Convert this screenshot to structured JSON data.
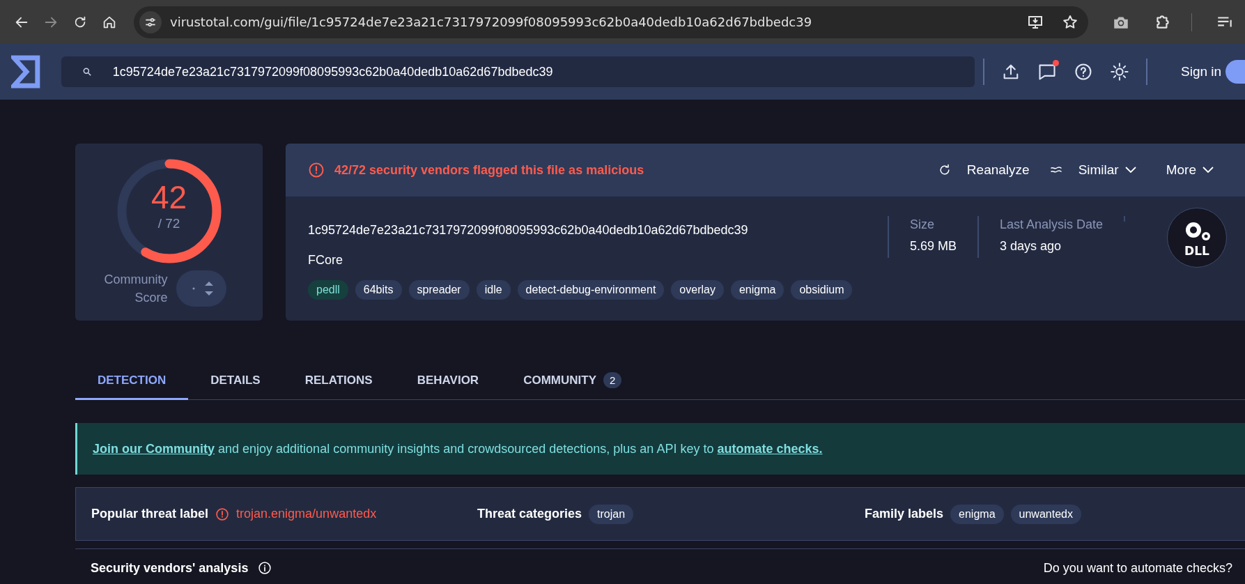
{
  "browser": {
    "url": "virustotal.com/gui/file/1c95724de7e23a21c7317972099f08095993c62b0a40dedb10a62d67bdbedc39",
    "forward_disabled": true
  },
  "header": {
    "search_value": "1c95724de7e23a21c7317972099f08095993c62b0a40dedb10a62d67bdbedc39",
    "sign_in": "Sign in",
    "notification": true
  },
  "score": {
    "detections": "42",
    "total": "/ 72",
    "level": 0.583,
    "community_label": "Community Score"
  },
  "alert": {
    "text": "42/72 security vendors flagged this file as malicious"
  },
  "actions": [
    {
      "kind": "reanalyze",
      "label": "Reanalyze",
      "dropdown": false
    },
    {
      "kind": "similar",
      "label": "Similar",
      "dropdown": true
    },
    {
      "kind": "more",
      "label": "More",
      "dropdown": true
    }
  ],
  "file": {
    "hash": "1c95724de7e23a21c7317972099f08095993c62b0a40dedb10a62d67bdbedc39",
    "name": "FCore",
    "tags": [
      {
        "label": "pedll",
        "highlighted": true
      },
      {
        "label": "64bits",
        "highlighted": false
      },
      {
        "label": "spreader",
        "highlighted": false
      },
      {
        "label": "idle",
        "highlighted": false
      },
      {
        "label": "detect-debug-environment",
        "highlighted": false
      },
      {
        "label": "overlay",
        "highlighted": false
      },
      {
        "label": "enigma",
        "highlighted": false
      },
      {
        "label": "obsidium",
        "highlighted": false
      }
    ],
    "meta": [
      {
        "label": "Size",
        "value": "5.69 MB"
      },
      {
        "label": "Last Analysis Date",
        "value": "3 days ago"
      }
    ],
    "type": "DLL"
  },
  "tabs": [
    {
      "label": "DETECTION",
      "selected": true
    },
    {
      "label": "DETAILS",
      "selected": false
    },
    {
      "label": "RELATIONS",
      "selected": false
    },
    {
      "label": "BEHAVIOR",
      "selected": false
    },
    {
      "label": "COMMUNITY",
      "selected": false,
      "badge": "2"
    }
  ],
  "banner": [
    {
      "kind": "link",
      "text": "Join our Community"
    },
    {
      "kind": "text",
      "text": "and enjoy additional community insights and crowdsourced detections, plus an API key to"
    },
    {
      "kind": "link",
      "text": "automate checks."
    }
  ],
  "threat": {
    "popular": {
      "label": "Popular threat label",
      "value": "trojan.enigma/unwantedx"
    },
    "categories": {
      "label": "Threat categories",
      "tags": [
        "trojan"
      ]
    },
    "family": {
      "label": "Family labels",
      "tags": [
        "enigma",
        "unwantedx"
      ]
    }
  },
  "vendors": {
    "title": "Security vendors' analysis",
    "prompt": "Do you want to automate checks?"
  }
}
